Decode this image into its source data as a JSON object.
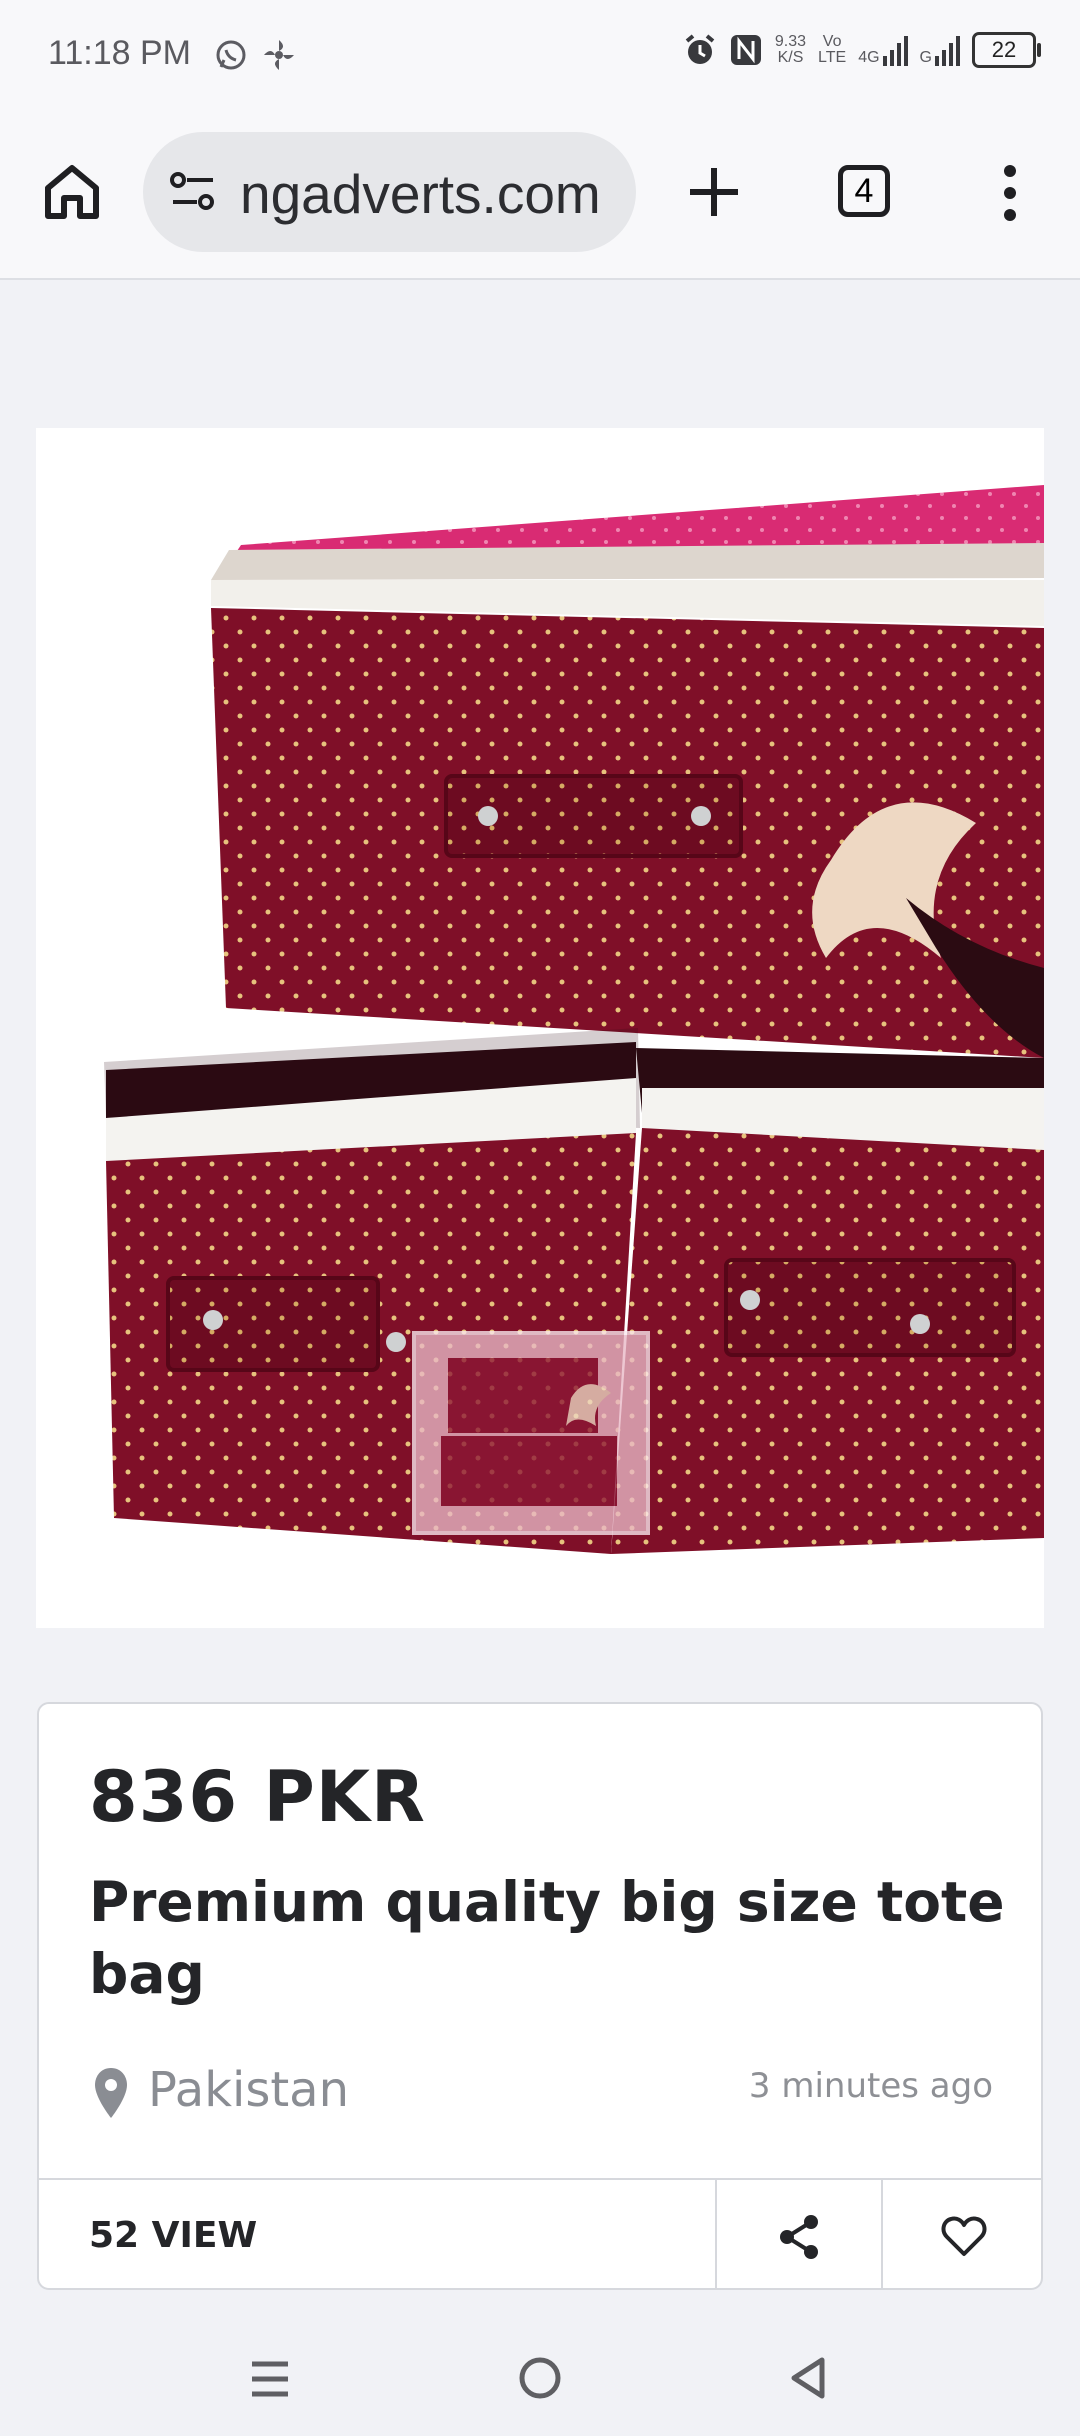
{
  "status_bar": {
    "time": "11:18 PM",
    "network_speed_value": "9.33",
    "network_speed_unit": "K/S",
    "volte_top": "Vo",
    "volte_bottom": "LTE",
    "network_4g": "4G",
    "network_g": "G",
    "battery": "22"
  },
  "browser": {
    "url": "ngadverts.com",
    "tab_count": "4"
  },
  "product": {
    "price": "836 PKR",
    "title": "Premium quality big size tote bag",
    "location": "Pakistan",
    "posted": "3 minutes ago",
    "views": "52 VIEW"
  },
  "colors": {
    "fabric": "#7f0f28",
    "pink_lid": "#d92b73",
    "bow": "#eed8c3"
  }
}
